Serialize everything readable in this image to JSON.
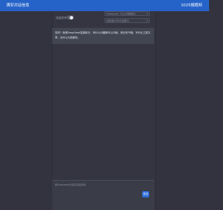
{
  "header": {
    "title": "满安对话信息",
    "right_link": "1025报题网"
  },
  "settings": {
    "deep_think_label": "深度思考",
    "deep_think_enabled": true,
    "model_select": "Deepseek（中心问题解答）",
    "mode_select": "选择提示词/中途提问"
  },
  "messages": [
    {
      "role": "assistant",
      "text": "您好！我是DeepSeek智能助手，有什么问题都可以问我。现在有不懂、写作业之类文章，也可以为您解答。"
    }
  ],
  "input": {
    "placeholder": "和Deepseek对话并发送消息"
  },
  "send_button": {
    "label": "发送"
  },
  "colors": {
    "header": "#2563c9",
    "background": "#33333f",
    "bubble": "#424552",
    "send": "#2f6fdc"
  }
}
